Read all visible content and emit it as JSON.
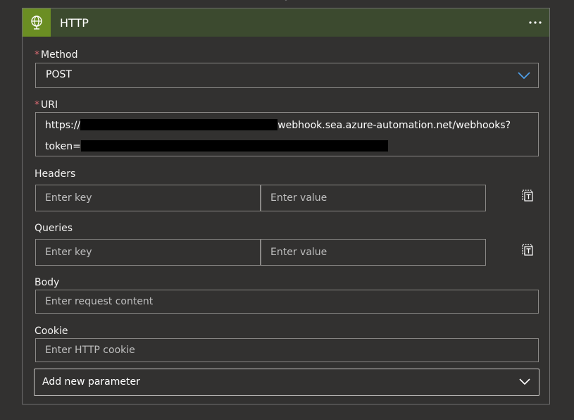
{
  "header": {
    "title": "HTTP",
    "more_label": "⋯"
  },
  "method": {
    "label": "Method",
    "required_mark": "*",
    "value": "POST"
  },
  "uri": {
    "label": "URI",
    "required_mark": "*",
    "line1_prefix": "https://",
    "line1_suffix": "webhook.sea.azure-automation.net/webhooks?",
    "line2_prefix": "token="
  },
  "headers": {
    "label": "Headers",
    "key_placeholder": "Enter key",
    "value_placeholder": "Enter value"
  },
  "queries": {
    "label": "Queries",
    "key_placeholder": "Enter key",
    "value_placeholder": "Enter value"
  },
  "body": {
    "label": "Body",
    "placeholder": "Enter request content"
  },
  "cookie": {
    "label": "Cookie",
    "placeholder": "Enter HTTP cookie"
  },
  "add_parameter": {
    "label": "Add new parameter"
  },
  "colors": {
    "header_bg": "#3c4a2f",
    "icon_bg": "#6b8e23",
    "chevron_accent": "#4f9fe8",
    "required": "#e06c75"
  },
  "icons": {
    "connector": "globe-icon",
    "more": "ellipsis-icon",
    "dropdown": "chevron-down-icon",
    "delete_row": "trash-icon"
  }
}
